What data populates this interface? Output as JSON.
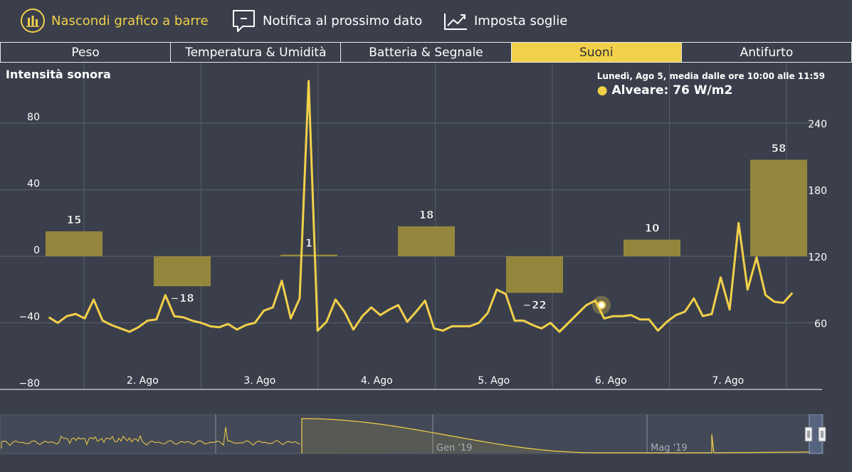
{
  "toolbar": {
    "bar_toggle": "Nascondi grafico a barre",
    "notify": "Notifica al prossimo dato",
    "thresholds": "Imposta soglie",
    "icons": [
      "bar-chart-icon",
      "message-icon",
      "trend-icon"
    ]
  },
  "tabs": [
    "Peso",
    "Temperatura & Umidità",
    "Batteria & Segnale",
    "Suoni",
    "Antifurto"
  ],
  "active_tab": 3,
  "tooltip": {
    "date": "Lunedì, Ago 5, media dalle ore 10:00 alle 11:59",
    "value": "Alveare: 76 W/m2"
  },
  "colors": {
    "accent": "#f2d04a",
    "background": "#3a3f4b",
    "bar": "#9a8a3c"
  },
  "chart_data": {
    "type": "bar+line",
    "title": "Intensità sonora",
    "x_ticks": [
      "2. Ago",
      "3. Ago",
      "4. Ago",
      "5. Ago",
      "6. Ago",
      "7. Ago"
    ],
    "y_left": {
      "ticks": [
        80,
        40,
        0,
        -40,
        -80
      ],
      "range": [
        -80,
        80
      ]
    },
    "y_right": {
      "ticks": [
        240,
        180,
        120,
        60
      ],
      "range": [
        0,
        240
      ]
    },
    "bars": [
      {
        "day": "1. Ago",
        "value": 15
      },
      {
        "day": "2. Ago",
        "value": -18
      },
      {
        "day": "3. Ago",
        "value": 1
      },
      {
        "day": "4. Ago",
        "value": 18
      },
      {
        "day": "5. Ago",
        "value": -22
      },
      {
        "day": "6. Ago",
        "value": 10
      },
      {
        "day": "7. Ago",
        "value": 58
      }
    ],
    "series": [
      {
        "name": "Alveare",
        "days": [
          0.7,
          7.05
        ],
        "values": [
          65,
          60,
          66,
          68,
          64,
          81,
          62,
          58,
          55,
          52,
          56,
          62,
          63,
          85,
          66,
          65,
          62,
          60,
          57,
          56,
          59,
          54,
          58,
          60,
          71,
          74,
          98,
          64,
          82,
          278,
          53,
          61,
          81,
          70,
          54,
          66,
          74,
          67,
          72,
          76,
          61,
          70,
          80,
          55,
          53,
          57,
          57,
          57,
          60,
          69,
          90,
          86,
          62,
          62,
          58,
          55,
          60,
          52,
          60,
          68,
          76,
          80,
          64,
          66,
          66,
          67,
          63,
          63,
          53,
          61,
          67,
          70,
          82,
          66,
          68,
          101,
          72,
          150,
          90,
          119,
          85,
          79,
          78,
          87
        ]
      }
    ],
    "highlight": {
      "day": "5. Ago",
      "value": 76
    },
    "navigator": {
      "labels": [
        "Gen '19",
        "Mag '19"
      ]
    }
  }
}
